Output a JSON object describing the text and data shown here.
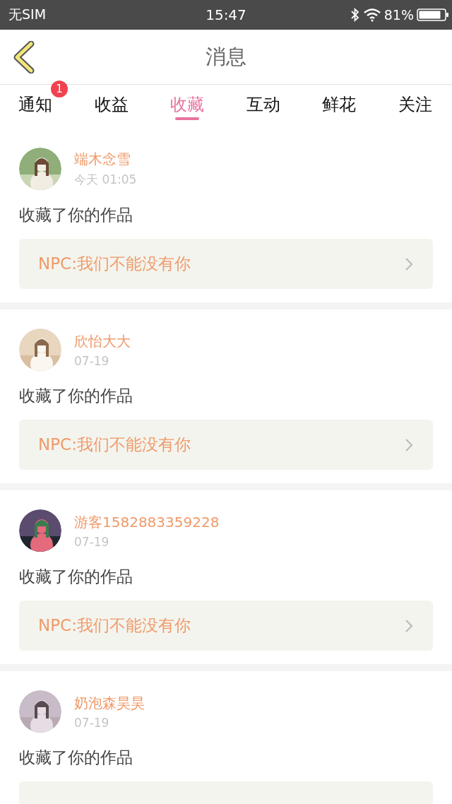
{
  "status_bar": {
    "carrier": "无SIM",
    "time": "15:47",
    "battery": "81%"
  },
  "header": {
    "title": "消息"
  },
  "tabs": [
    {
      "label": "通知",
      "selected": false,
      "badge": "1"
    },
    {
      "label": "收益",
      "selected": false
    },
    {
      "label": "收藏",
      "selected": true
    },
    {
      "label": "互动",
      "selected": false
    },
    {
      "label": "鲜花",
      "selected": false
    },
    {
      "label": "关注",
      "selected": false
    }
  ],
  "messages": [
    {
      "user": "端木念雪",
      "time": "今天 01:05",
      "text": "收藏了你的作品",
      "work": "NPC:我们不能没有你"
    },
    {
      "user": "欣怡大大",
      "time": "07-19",
      "text": "收藏了你的作品",
      "work": "NPC:我们不能没有你"
    },
    {
      "user": "游客1582883359228",
      "time": "07-19",
      "text": "收藏了你的作品",
      "work": "NPC:我们不能没有你"
    },
    {
      "user": "奶泡森昊昊",
      "time": "07-19",
      "text": "收藏了你的作品"
    }
  ]
}
